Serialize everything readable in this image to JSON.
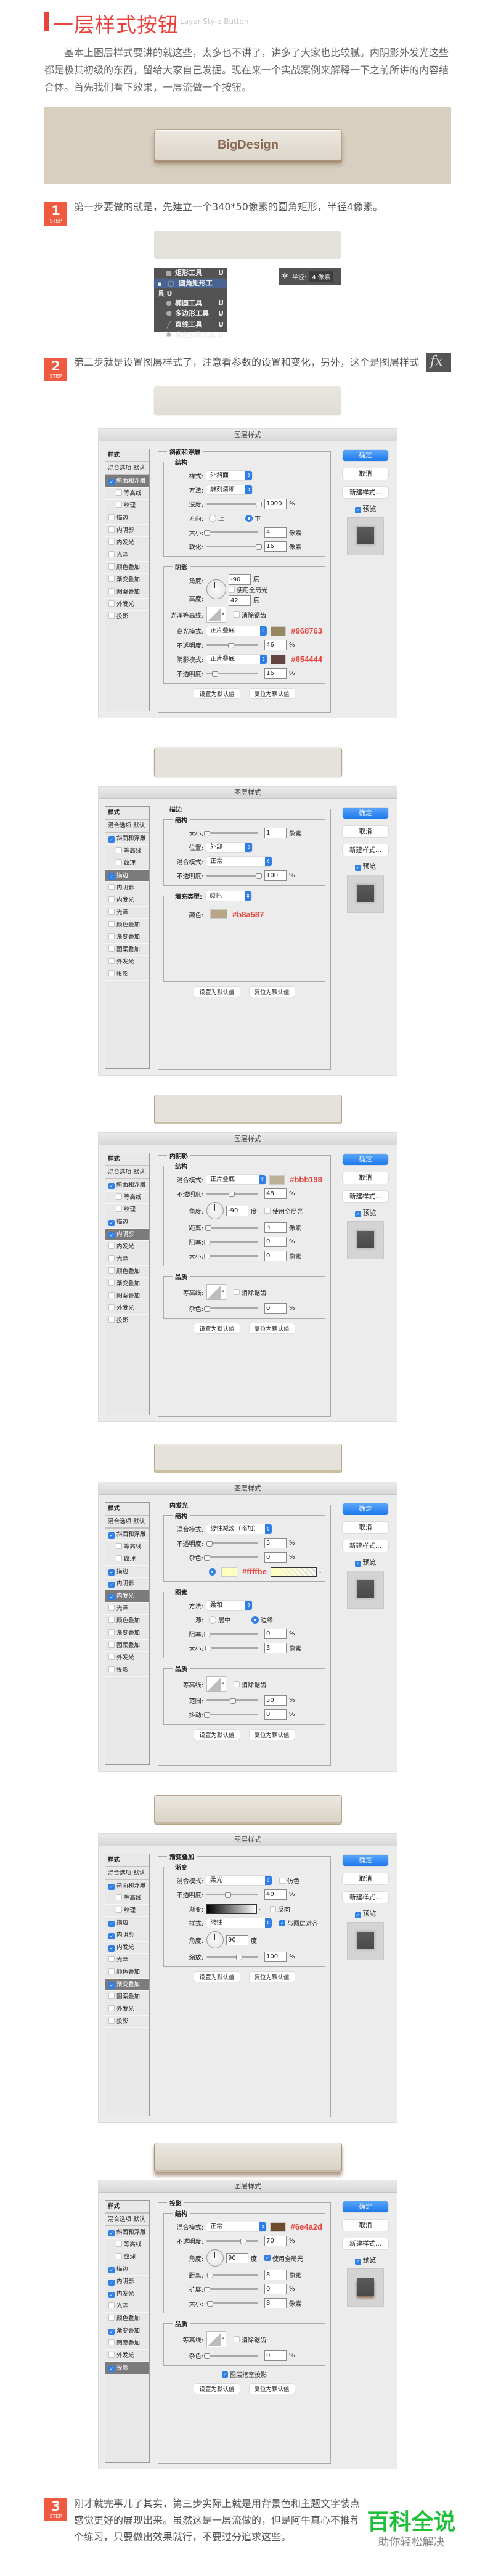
{
  "header": {
    "title": "一层样式按钮",
    "subtitle": "Layer Style Button"
  },
  "intro": "基本上图层样式要讲的就这些，太多也不讲了，讲多了大家也比较腻。内阴影外发光这些都是极其初级的东西，留给大家自己发掘。现在来一个实战案例来解释一下之前所讲的内容结合体。首先我们看下效果，一层流做一个按钮。",
  "banner": {
    "button_label": "BigDesign"
  },
  "step_label": "STEP",
  "steps": [
    {
      "number": "1",
      "text": "第一步要做的就是，先建立一个340*50像素的圆角矩形，半径4像素。"
    },
    {
      "number": "2",
      "text": "第二步就是设置图层样式了，注意看参数的设置和变化，另外，这个是图层样式",
      "icon": "fx-icon",
      "icon_glyph": "fx"
    },
    {
      "number": "3",
      "lines": [
        "刚才就完事儿了其实，第三步实际上就是用背景色和主题文字装点",
        "感觉更好的展现出来。虽然这是一层流做的，但是阿牛真心不推荐",
        "个练习，只要做出效果就行，不要过分追求这些。"
      ]
    }
  ],
  "tool_menu": [
    {
      "label": "矩形工具",
      "key": "U",
      "icon": "rectangle-tool-icon",
      "selected": false
    },
    {
      "label": "圆角矩形工具",
      "key": "U",
      "icon": "rounded-rectangle-tool-icon",
      "selected": true
    },
    {
      "label": "椭圆工具",
      "key": "U",
      "icon": "ellipse-tool-icon",
      "selected": false
    },
    {
      "label": "多边形工具",
      "key": "U",
      "icon": "polygon-tool-icon",
      "selected": false
    },
    {
      "label": "直线工具",
      "key": "U",
      "icon": "line-tool-icon",
      "selected": false
    },
    {
      "label": "自定形状工具",
      "key": "U",
      "icon": "custom-shape-tool-icon",
      "selected": false
    }
  ],
  "radius_panel": {
    "label": "半径:",
    "value": "4 像素"
  },
  "dialog_common": {
    "title": "图层样式",
    "styles_header": "样式",
    "blend_default": "混合选项:默认",
    "effects": [
      "斜面和浮雕",
      "等高线",
      "纹理",
      "描边",
      "内阴影",
      "内发光",
      "光泽",
      "颜色叠加",
      "渐变叠加",
      "图案叠加",
      "外发光",
      "投影"
    ],
    "ok": "确定",
    "cancel": "取消",
    "new_style": "新建样式...",
    "preview": "预览",
    "set_default": "设置为默认值",
    "reset_default": "复位为默认值"
  },
  "dialogs": [
    {
      "checked": [
        0
      ],
      "active": 0,
      "section": "斜面和浮雕",
      "groups": [
        {
          "title": "结构",
          "rows": [
            {
              "t": "select",
              "label": "样式:",
              "value": "外斜面"
            },
            {
              "t": "select",
              "label": "方法:",
              "value": "雕刻清晰"
            },
            {
              "t": "slider",
              "label": "深度:",
              "value": "1000",
              "unit": "%",
              "pos": 1
            },
            {
              "t": "radio",
              "label": "方向:",
              "options": [
                "上",
                "下"
              ],
              "selected": 1
            },
            {
              "t": "slider",
              "label": "大小:",
              "value": "4",
              "unit": "像素",
              "pos": 0
            },
            {
              "t": "slider",
              "label": "软化:",
              "value": "16",
              "unit": "像素",
              "pos": 1
            }
          ]
        },
        {
          "title": "阴影",
          "rows": [
            {
              "t": "angle2",
              "label": "角度:",
              "value": "-90",
              "unit": "度",
              "check": {
                "label": "使用全局光",
                "checked": false
              },
              "label2": "高度:",
              "value2": "42",
              "unit2": "度"
            },
            {
              "t": "contour",
              "label": "光泽等高线:",
              "check": {
                "label": "消除锯齿",
                "checked": false
              }
            },
            {
              "t": "select",
              "label": "高光模式:",
              "value": "正片叠底",
              "swatch": "#968763",
              "hex": "#968763"
            },
            {
              "t": "slider",
              "label": "不透明度:",
              "value": "46",
              "unit": "%",
              "pos": 0.46
            },
            {
              "t": "select",
              "label": "阴影模式:",
              "value": "正片叠底",
              "swatch": "#654444",
              "hex": "#654444"
            },
            {
              "t": "slider",
              "label": "不透明度:",
              "value": "16",
              "unit": "%",
              "pos": 0.16
            }
          ]
        }
      ]
    },
    {
      "checked": [
        0,
        3
      ],
      "active": 3,
      "section": "描边",
      "groups": [
        {
          "title": "结构",
          "rows": [
            {
              "t": "slider",
              "label": "大小:",
              "value": "1",
              "unit": "像素",
              "pos": 0
            },
            {
              "t": "select",
              "label": "位置:",
              "value": "外部"
            },
            {
              "t": "select",
              "label": "混合模式:",
              "value": "正常",
              "wide": true
            },
            {
              "t": "slider",
              "label": "不透明度:",
              "value": "100",
              "unit": "%",
              "pos": 1
            }
          ]
        },
        {
          "title": "填充类型:",
          "title_select": "颜色",
          "rows": [
            {
              "t": "swatch",
              "label": "颜色:",
              "swatch": "#b8a587",
              "hex": "#b8a587"
            }
          ]
        }
      ]
    },
    {
      "checked": [
        0,
        3,
        4
      ],
      "active": 4,
      "section": "内阴影",
      "groups": [
        {
          "title": "结构",
          "rows": [
            {
              "t": "select",
              "label": "混合模式:",
              "value": "正片叠底",
              "swatch": "#bbb198",
              "hex": "#bbb198"
            },
            {
              "t": "slider",
              "label": "不透明度:",
              "value": "48",
              "unit": "%",
              "pos": 0.48
            },
            {
              "t": "angle",
              "label": "角度:",
              "value": "-90",
              "unit": "度",
              "check": {
                "label": "使用全局光",
                "checked": false
              }
            },
            {
              "t": "slider",
              "label": "距离:",
              "value": "3",
              "unit": "像素",
              "pos": 0.02
            },
            {
              "t": "slider",
              "label": "阻塞:",
              "value": "0",
              "unit": "%",
              "pos": 0
            },
            {
              "t": "slider",
              "label": "大小:",
              "value": "0",
              "unit": "像素",
              "pos": 0
            }
          ]
        },
        {
          "title": "品质",
          "rows": [
            {
              "t": "contour",
              "label": "等高线:",
              "check": {
                "label": "消除锯齿",
                "checked": false
              }
            },
            {
              "t": "slider",
              "label": "杂色:",
              "value": "0",
              "unit": "%",
              "pos": 0
            }
          ]
        }
      ]
    },
    {
      "checked": [
        0,
        3,
        4,
        5
      ],
      "active": 5,
      "section": "内发光",
      "groups": [
        {
          "title": "结构",
          "rows": [
            {
              "t": "select",
              "label": "混合模式:",
              "value": "线性减淡（添加）",
              "wide": true
            },
            {
              "t": "slider",
              "label": "不透明度:",
              "value": "5",
              "unit": "%",
              "pos": 0.05
            },
            {
              "t": "slider",
              "label": "杂色:",
              "value": "0",
              "unit": "%",
              "pos": 0
            },
            {
              "t": "glow",
              "swatch": "#ffffbe",
              "hex": "#ffffbe"
            }
          ]
        },
        {
          "title": "图素",
          "rows": [
            {
              "t": "select",
              "label": "方法:",
              "value": "柔和"
            },
            {
              "t": "radio",
              "label": "源:",
              "options": [
                "居中",
                "边缘"
              ],
              "selected": 1
            },
            {
              "t": "slider",
              "label": "阻塞:",
              "value": "0",
              "unit": "%",
              "pos": 0
            },
            {
              "t": "slider",
              "label": "大小:",
              "value": "3",
              "unit": "像素",
              "pos": 0.02
            }
          ]
        },
        {
          "title": "品质",
          "rows": [
            {
              "t": "contour",
              "label": "等高线:",
              "check": {
                "label": "消除锯齿",
                "checked": false
              }
            },
            {
              "t": "slider",
              "label": "范围:",
              "value": "50",
              "unit": "%",
              "pos": 0.5
            },
            {
              "t": "slider",
              "label": "抖动:",
              "value": "0",
              "unit": "%",
              "pos": 0
            }
          ]
        }
      ]
    },
    {
      "checked": [
        0,
        3,
        4,
        5,
        8
      ],
      "active": 8,
      "section": "渐变叠加",
      "groups": [
        {
          "title": "渐变",
          "rows": [
            {
              "t": "select",
              "label": "混合模式:",
              "value": "柔光",
              "wide": true,
              "check": {
                "label": "仿色",
                "checked": false
              }
            },
            {
              "t": "slider",
              "label": "不透明度:",
              "value": "40",
              "unit": "%",
              "pos": 0.4
            },
            {
              "t": "gradient",
              "label": "渐变:",
              "check": {
                "label": "反向",
                "checked": false
              }
            },
            {
              "t": "select",
              "label": "样式:",
              "value": "线性",
              "wide": true,
              "check": {
                "label": "与图层对齐",
                "checked": true
              }
            },
            {
              "t": "angle",
              "label": "角度:",
              "value": "90",
              "unit": "度"
            },
            {
              "t": "slider",
              "label": "缩放:",
              "value": "100",
              "unit": "%",
              "pos": 0.62
            }
          ]
        }
      ]
    },
    {
      "checked": [
        0,
        3,
        4,
        5,
        8,
        11
      ],
      "active": 11,
      "section": "投影",
      "groups": [
        {
          "title": "结构",
          "rows": [
            {
              "t": "select",
              "label": "混合模式:",
              "value": "正常",
              "swatch": "#6e4a2d",
              "hex": "#6e4a2d"
            },
            {
              "t": "slider",
              "label": "不透明度:",
              "value": "70",
              "unit": "%",
              "pos": 0.7
            },
            {
              "t": "angle",
              "label": "角度:",
              "value": "90",
              "unit": "度",
              "check": {
                "label": "使用全局光",
                "checked": true
              }
            },
            {
              "t": "slider",
              "label": "距离:",
              "value": "8",
              "unit": "像素",
              "pos": 0.06
            },
            {
              "t": "slider",
              "label": "扩展:",
              "value": "0",
              "unit": "%",
              "pos": 0
            },
            {
              "t": "slider",
              "label": "大小:",
              "value": "8",
              "unit": "像素",
              "pos": 0.06
            }
          ]
        },
        {
          "title": "品质",
          "rows": [
            {
              "t": "contour",
              "label": "等高线:",
              "check": {
                "label": "消除锯齿",
                "checked": false
              }
            },
            {
              "t": "slider",
              "label": "杂色:",
              "value": "0",
              "unit": "%",
              "pos": 0
            }
          ]
        }
      ],
      "footer_check": {
        "label": "图层挖空投影",
        "checked": true
      }
    }
  ],
  "watermark": {
    "title": "百科全说",
    "subtitle": "助你轻松解决"
  },
  "colors": {
    "accent": "#e8433a",
    "step_badge": "#f05a40",
    "banner_bg": "#d8cfc0",
    "button_text": "#8a6a55",
    "watermark_green": "#1fbf3a"
  }
}
